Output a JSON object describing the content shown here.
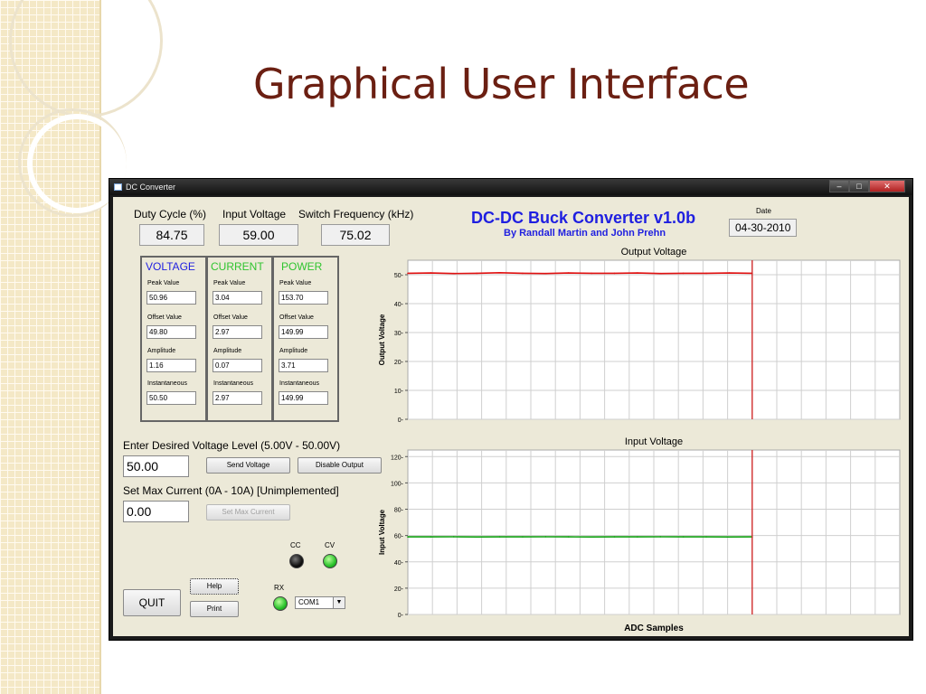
{
  "slide": {
    "title": "Graphical User Interface"
  },
  "window": {
    "title": "DC Converter",
    "controls": [
      "minimize",
      "maximize",
      "close"
    ]
  },
  "params": {
    "duty_cycle": {
      "label": "Duty Cycle (%)",
      "value": "84.75"
    },
    "input_voltage": {
      "label": "Input Voltage",
      "value": "59.00"
    },
    "switch_frequency": {
      "label": "Switch Frequency (kHz)",
      "value": "75.02"
    }
  },
  "header": {
    "app_title": "DC-DC Buck Converter v1.0b",
    "authors": "By Randall Martin and John Prehn",
    "date_label": "Date",
    "date_value": "04-30-2010"
  },
  "groups": {
    "voltage": {
      "title": "VOLTAGE",
      "color": "#1f1fe0",
      "labels": [
        "Peak Value",
        "Offset Value",
        "Amplitude",
        "Instantaneous"
      ],
      "values": [
        "50.96",
        "49.80",
        "1.16",
        "50.50"
      ]
    },
    "current": {
      "title": "CURRENT",
      "color": "#2fc42f",
      "labels": [
        "Peak Value",
        "Offset Value",
        "Amplitude",
        "Instantaneous"
      ],
      "values": [
        "3.04",
        "2.97",
        "0.07",
        "2.97"
      ]
    },
    "power": {
      "title": "POWER",
      "color": "#2fc42f",
      "labels": [
        "Peak Value",
        "Offset Value",
        "Amplitude",
        "Instantaneous"
      ],
      "values": [
        "153.70",
        "149.99",
        "3.71",
        "149.99"
      ]
    }
  },
  "voltage_control": {
    "label": "Enter Desired Voltage Level (5.00V - 50.00V)",
    "value": "50.00",
    "send_button": "Send Voltage",
    "disable_button": "Disable Output"
  },
  "current_control": {
    "label": "Set Max Current (0A - 10A) [Unimplemented]",
    "value": "0.00",
    "set_button": "Set Max Current"
  },
  "indicators": {
    "cc_label": "CC",
    "cv_label": "CV",
    "rx_label": "RX"
  },
  "buttons": {
    "quit": "QUIT",
    "help": "Help",
    "print": "Print"
  },
  "com_port": {
    "selected": "COM1"
  },
  "colors": {
    "voltage_trace": "#e01010",
    "input_trace": "#10a010",
    "marker": "#d02020"
  },
  "chart_data": [
    {
      "type": "line",
      "title": "Output Voltage",
      "ylabel": "Output Voltage",
      "xlabel": "",
      "yticks": [
        "0",
        "10",
        "20",
        "30",
        "40",
        "50"
      ],
      "ylim": [
        0,
        55
      ],
      "series": [
        {
          "values": [
            50.5,
            50.6,
            50.4,
            50.5,
            50.7,
            50.5,
            50.4,
            50.6,
            50.5,
            50.5,
            50.6,
            50.4,
            50.5,
            50.5,
            50.6,
            50.5
          ]
        }
      ],
      "grid": true
    },
    {
      "type": "line",
      "title": "Input Voltage",
      "ylabel": "Input Voltage",
      "xlabel": "ADC Samples",
      "yticks": [
        "0",
        "20",
        "40",
        "60",
        "80",
        "100",
        "120"
      ],
      "ylim": [
        0,
        125
      ],
      "series": [
        {
          "values": [
            59,
            59,
            59.1,
            58.9,
            59,
            59,
            59.1,
            59,
            58.9,
            59,
            59,
            59.1,
            59,
            59,
            58.9,
            59
          ]
        }
      ],
      "grid": true
    }
  ]
}
